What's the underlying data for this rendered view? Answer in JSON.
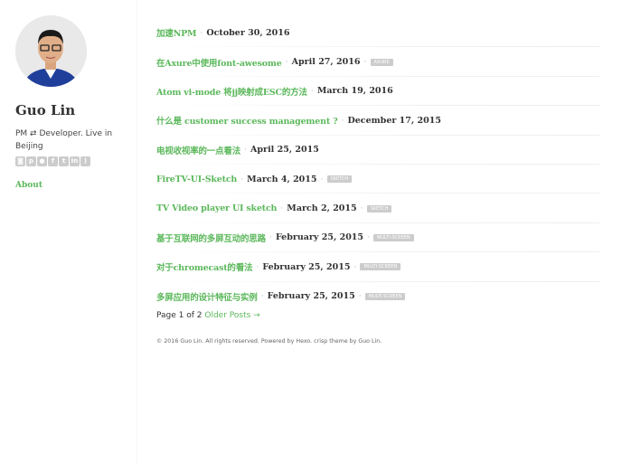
{
  "sidebar": {
    "name": "Guo Lin",
    "bio": "PM ⇄ Developer. Live in Beijing",
    "social": [
      "instagram",
      "pinterest",
      "github",
      "facebook",
      "twitter",
      "linkedin",
      "rss"
    ],
    "about": "About"
  },
  "posts": [
    {
      "title": "加速NPM",
      "date": "October 30, 2016",
      "tag": null
    },
    {
      "title": "在Axure中使用font-awesome",
      "date": "April 27, 2016",
      "tag": "axure"
    },
    {
      "title": "Atom vi-mode 将jj映射成ESC的方法",
      "date": "March 19, 2016",
      "tag": null
    },
    {
      "title": "什么是 customer success management ?",
      "date": "December 17, 2015",
      "tag": null
    },
    {
      "title": "电视收视率的一点看法",
      "date": "April 25, 2015",
      "tag": null
    },
    {
      "title": "FireTV-UI-Sketch",
      "date": "March 4, 2015",
      "tag": "sketch"
    },
    {
      "title": "TV Video player UI sketch",
      "date": "March 2, 2015",
      "tag": "sketch"
    },
    {
      "title": "基于互联网的多屏互动的思路",
      "date": "February 25, 2015",
      "tag": "multi-screen"
    },
    {
      "title": "对于chromecast的看法",
      "date": "February 25, 2015",
      "tag": "multi-screen"
    },
    {
      "title": "多屏应用的设计特征与实例",
      "date": "February 25, 2015",
      "tag": "multi-screen"
    }
  ],
  "pager": {
    "text": "Page 1 of 2",
    "older": "Older Posts →"
  },
  "footer": {
    "pre": "© 2016 Guo Lin. All rights reserved. Powered by ",
    "hexo": "Hexo",
    "sep": ". ",
    "crisp": "crisp",
    "mid": " theme by ",
    "author": "Guo Lin",
    "end": "."
  }
}
